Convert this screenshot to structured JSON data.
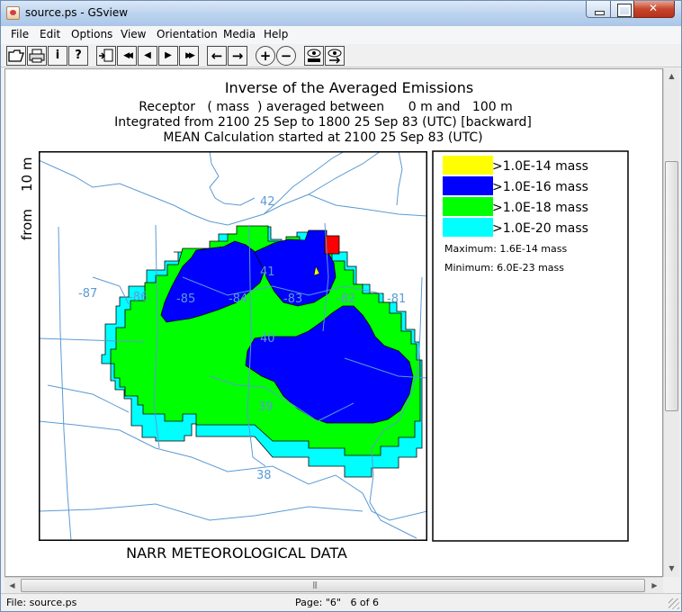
{
  "window": {
    "title": "source.ps - GSview"
  },
  "menu": [
    "File",
    "Edit",
    "Options",
    "View",
    "Orientation",
    "Media",
    "Help"
  ],
  "toolbar": {
    "open_icon": "folder-open-icon",
    "print_icon": "printer-icon",
    "info_label": "i",
    "help_label": "?",
    "goto_icon": "hand-page-icon",
    "first_label": "◀◀",
    "prev_label": "◀",
    "next_label": "▶",
    "last_label": "▶▶",
    "back_label": "←",
    "forward_label": "→",
    "zoom_in_label": "+",
    "zoom_out_label": "−",
    "find_icon": "eye-abc-icon",
    "find_next_icon": "eye-arrow-icon"
  },
  "plot": {
    "title": "Inverse of the Averaged Emissions",
    "line2": "Receptor   ( mass  ) averaged between      0 m and   100 m",
    "line3": "Integrated from 2100 25 Sep to 1800 25 Sep 83 (UTC) [backward]",
    "line4": "MEAN Calculation started at 2100 25 Sep 83 (UTC)",
    "side_label": "from    10 m",
    "footer": "NARR METEOROLOGICAL DATA",
    "map": {
      "longitude_labels": [
        "-87",
        "-86",
        "-85",
        "-84",
        "-83",
        "-82",
        "-81"
      ],
      "latitude_labels": [
        "42",
        "41",
        "40",
        "39",
        "38"
      ]
    },
    "legend": {
      "entries": [
        {
          "label": ">1.0E-14  mass",
          "color": "#ffff00"
        },
        {
          "label": ">1.0E-16  mass",
          "color": "#0000ff"
        },
        {
          "label": ">1.0E-18  mass",
          "color": "#00ff00"
        },
        {
          "label": ">1.0E-20  mass",
          "color": "#00ffff"
        }
      ],
      "maximum": "Maximum: 1.6E-14  mass",
      "minimum": "Minimum: 6.0E-23  mass"
    }
  },
  "status": {
    "file": "File: source.ps",
    "page": "Page: \"6\"   6 of 6"
  },
  "colors": {
    "map_lines": "#5b9bd5",
    "source_marker": "#ff0000",
    "contour_blue": "#0000ff",
    "contour_green": "#00ff00",
    "contour_cyan": "#00ffff"
  }
}
